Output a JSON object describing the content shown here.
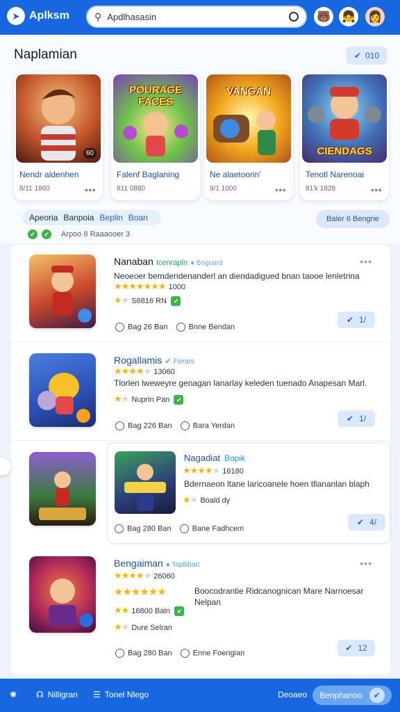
{
  "app": {
    "name": "Aplksm"
  },
  "search": {
    "value": "Apdlhasasin"
  },
  "hero": {
    "title": "Naplamian",
    "badge": "010"
  },
  "featured": [
    {
      "name": "Nendr aldenhen",
      "meta": "8/11 1860",
      "meta2": "●●●",
      "badge": "60",
      "art": "Hero"
    },
    {
      "name": "Falenf  Baglaning",
      "meta": "811 0880",
      "meta2": "",
      "badge": "",
      "art": "POURAGE FACES"
    },
    {
      "name": "Ne alaetoorin'",
      "meta": "8/1 1000",
      "meta2": "●●●",
      "badge": "",
      "art": "VANGAN"
    },
    {
      "name": "Tenotl Narenoai",
      "meta": "81'k 1828",
      "meta2": "●●●",
      "badge": "",
      "art": "CIENDAGS"
    }
  ],
  "filter": {
    "label1": "Apeoria",
    "label2": "Banpoia",
    "label3": "Beplin",
    "label4": "Boan",
    "sub": "Arpoo 8 Raaaooer 3"
  },
  "sort": {
    "label": "Baler 6  Bengrie"
  },
  "list": [
    {
      "title": "Nanaban",
      "tag": "Icenrapln",
      "tag2": "● Bogoard",
      "desc": "Neoeoer bemdendenanderl an diendadigued bnan taooe lenletrina",
      "stars": "1000",
      "stars2": "S6816 RN",
      "time": "Bag 26 Ban",
      "by": "Bnne  Bendan",
      "btn": "1/"
    },
    {
      "title": "Rogallamis",
      "tag": "✔ Fenes",
      "tag2": "",
      "desc": "Tlorlen lweweyre genagan lanarlay keleden tuenado Anapesan Marl.",
      "stars": "13060",
      "stars2": "Nuprin Pan",
      "time": "Bag 226 Ban",
      "by": "Bara  Yerdan",
      "btn": "1/"
    },
    {
      "title": "Nagadiat",
      "tag": "Bopik",
      "tag2": "",
      "desc": "Bdernaeon ltane laricoanele hoen tllananlan blaph",
      "stars": "16180",
      "stars2": "Boald dy",
      "time": "Bag 280 Ban",
      "by": "Bane  Fadhcem",
      "btn": "4/"
    },
    {
      "title": "Bengaiman",
      "tag2": "● Topllibart",
      "tag": "",
      "desc": "Boocodrantie Ridcanognican Mare Narnoesar Nelpan",
      "stars": "26060",
      "stars2": "16800 Bain",
      "stars3": "Dure  Selran",
      "time": "Bag 280 Ban",
      "by": "Enne  Foengian",
      "btn": "12"
    }
  ],
  "bottom": {
    "item1": "Nilligran",
    "item2": "Tonel Nlego",
    "item3": "Deoaeo",
    "pill": "Benphanoo"
  }
}
